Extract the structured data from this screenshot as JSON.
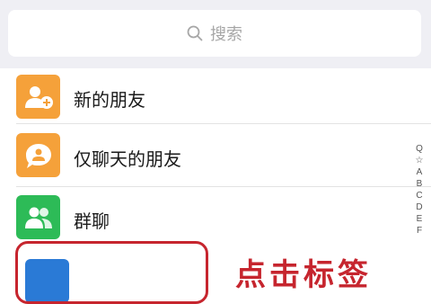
{
  "search": {
    "placeholder": "搜索",
    "icon": "search-icon"
  },
  "items": [
    {
      "label": "新的朋友",
      "icon": "new-friend-icon",
      "color": "#f5a13a"
    },
    {
      "label": "仅聊天的朋友",
      "icon": "chat-only-friend-icon",
      "color": "#f5a13a"
    },
    {
      "label": "群聊",
      "icon": "group-chat-icon",
      "color": "#2dbb57"
    }
  ],
  "partial_item": {
    "icon": "tag-icon",
    "color": "#2a7ad6"
  },
  "index_bar": [
    "Q",
    "☆",
    "A",
    "B",
    "C",
    "D",
    "E",
    "F"
  ],
  "annotation": {
    "text": "点击标签",
    "color": "#c6252e"
  }
}
